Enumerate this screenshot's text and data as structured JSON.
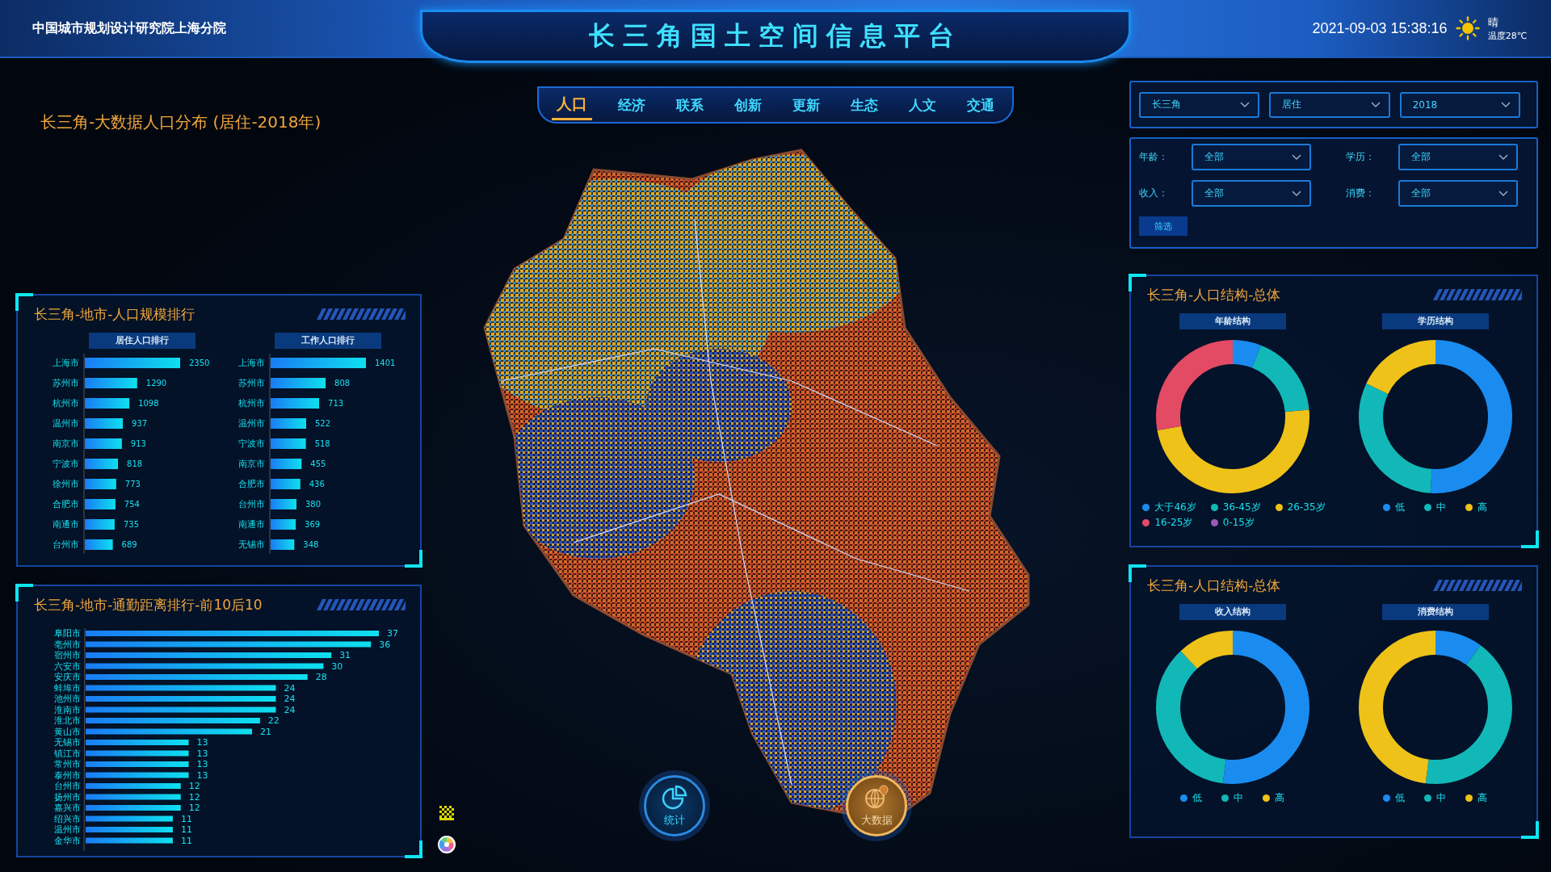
{
  "header": {
    "org": "中国城市规划设计研究院上海分院",
    "title": "长三角国土空间信息平台",
    "datetime": "2021-09-03 15:38:16",
    "weather": {
      "condition": "晴",
      "temperature": "温度28℃"
    }
  },
  "nav_tabs": [
    {
      "label": "人口",
      "selected": true
    },
    {
      "label": "经济",
      "selected": false
    },
    {
      "label": "联系",
      "selected": false
    },
    {
      "label": "创新",
      "selected": false
    },
    {
      "label": "更新",
      "selected": false
    },
    {
      "label": "生态",
      "selected": false
    },
    {
      "label": "人文",
      "selected": false
    },
    {
      "label": "交通",
      "selected": false
    }
  ],
  "map_title": "长三角-大数据人口分布 (居住-2018年)",
  "map_controls": [
    {
      "label": "统计",
      "kind": "stats"
    },
    {
      "label": "大数据",
      "kind": "bigdata"
    }
  ],
  "selectors": [
    {
      "value": "长三角"
    },
    {
      "value": "居住"
    },
    {
      "value": "2018"
    }
  ],
  "filters": [
    {
      "label": "年龄：",
      "value": "全部"
    },
    {
      "label": "学历：",
      "value": "全部"
    },
    {
      "label": "收入：",
      "value": "全部"
    },
    {
      "label": "消费：",
      "value": "全部"
    }
  ],
  "filter_button": "筛选",
  "population_ranking": {
    "title": "长三角-地市-人口规模排行",
    "charts": [
      {
        "heading": "居住人口排行",
        "chart_data": {
          "type": "bar",
          "orientation": "horizontal",
          "categories": [
            "上海市",
            "苏州市",
            "杭州市",
            "温州市",
            "南京市",
            "宁波市",
            "徐州市",
            "合肥市",
            "南通市",
            "台州市"
          ],
          "values": [
            2350,
            1290,
            1098,
            937,
            913,
            818,
            773,
            754,
            735,
            689
          ],
          "data_labels": true
        }
      },
      {
        "heading": "工作人口排行",
        "chart_data": {
          "type": "bar",
          "orientation": "horizontal",
          "categories": [
            "上海市",
            "苏州市",
            "杭州市",
            "温州市",
            "宁波市",
            "南京市",
            "合肥市",
            "台州市",
            "南通市",
            "无锡市"
          ],
          "values": [
            1401,
            808,
            713,
            522,
            518,
            455,
            436,
            380,
            369,
            348
          ],
          "data_labels": true
        }
      }
    ]
  },
  "commute_ranking": {
    "title": "长三角-地市-通勤距离排行-前10后10",
    "chart_data": {
      "type": "bar",
      "orientation": "horizontal",
      "categories": [
        "阜阳市",
        "亳州市",
        "宿州市",
        "六安市",
        "安庆市",
        "蚌埠市",
        "池州市",
        "淮南市",
        "淮北市",
        "黄山市",
        "无锡市",
        "镇江市",
        "常州市",
        "泰州市",
        "台州市",
        "扬州市",
        "嘉兴市",
        "绍兴市",
        "温州市",
        "金华市"
      ],
      "values": [
        37,
        36,
        31,
        30,
        28,
        24,
        24,
        24,
        22,
        21,
        13,
        13,
        13,
        13,
        12,
        12,
        12,
        11,
        11,
        11
      ],
      "data_labels": true
    }
  },
  "structure_panels": [
    {
      "title": "长三角-人口结构-总体",
      "charts": [
        {
          "heading": "年龄结构",
          "legend": [
            {
              "label": "大于46岁",
              "color": "#1a8cf0"
            },
            {
              "label": "36-45岁",
              "color": "#12b8b8"
            },
            {
              "label": "26-35岁",
              "color": "#eec218"
            },
            {
              "label": "16-25岁",
              "color": "#e34a64"
            },
            {
              "label": "0-15岁",
              "color": "#9b59b6"
            }
          ]
        },
        {
          "heading": "学历结构",
          "legend": [
            {
              "label": "低",
              "color": "#1a8cf0"
            },
            {
              "label": "中",
              "color": "#12b8b8"
            },
            {
              "label": "高",
              "color": "#eec218"
            }
          ]
        }
      ]
    },
    {
      "title": "长三角-人口结构-总体",
      "charts": [
        {
          "heading": "收入结构",
          "legend": [
            {
              "label": "低",
              "color": "#1a8cf0"
            },
            {
              "label": "中",
              "color": "#12b8b8"
            },
            {
              "label": "高",
              "color": "#eec218"
            }
          ]
        },
        {
          "heading": "消费结构",
          "legend": [
            {
              "label": "低",
              "color": "#1a8cf0"
            },
            {
              "label": "中",
              "color": "#12b8b8"
            },
            {
              "label": "高",
              "color": "#eec218"
            }
          ]
        }
      ]
    }
  ]
}
